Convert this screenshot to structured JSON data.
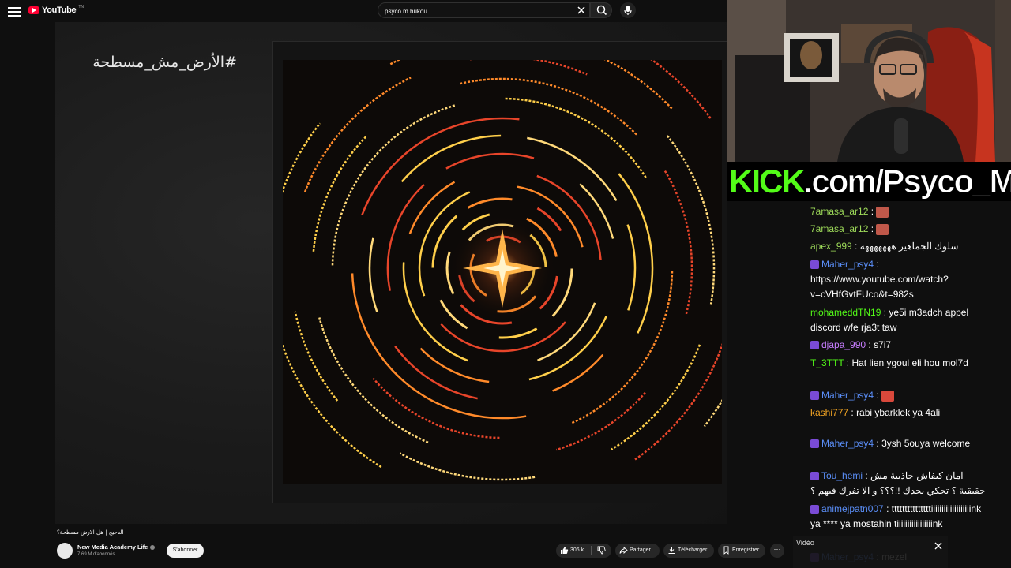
{
  "header": {
    "logo_text": "YouTube",
    "logo_tm": "TN",
    "search": {
      "value": "psyco m hukou"
    }
  },
  "video": {
    "hashtag": "#الأرض_مش_مسطحة",
    "title": "الدحيح | هل الارض مسطحة؟",
    "channel": {
      "name": "New Media Academy Life",
      "subscribers": "7,69 M d'abonnés"
    },
    "subscribe_label": "S'abonner",
    "actions": {
      "likes": "306 k",
      "share": "Partager",
      "download": "Télécharger",
      "save": "Enregistrer",
      "more": "···"
    }
  },
  "stream": {
    "banner": {
      "green": "KICK",
      "rest": ".com/Psyco_M"
    }
  },
  "chat": {
    "messages": [
      {
        "user": "7amasa_ar12",
        "user_color": "#9fdc5a",
        "text": "",
        "emote": true,
        "emote_color": "#c0584a"
      },
      {
        "user": "7amasa_ar12",
        "user_color": "#9fdc5a",
        "text": "",
        "emote": true,
        "emote_color": "#c0584a"
      },
      {
        "user": "apex_999",
        "user_color": "#9fdc5a",
        "text": "سلوك الجماهير هههههههه"
      },
      {
        "user": "Maher_psy4",
        "user_color": "#5b8ff9",
        "text": "https://www.youtube.com/watch?v=cVHfGvtFUco&t=982s"
      },
      {
        "user": "mohameddTN19",
        "user_color": "#53fc18",
        "text": "ye5i m3adch appel discord wfe rja3t taw"
      },
      {
        "user": "djapa_990",
        "user_color": "#c77dff",
        "text": "s7i7"
      },
      {
        "user": "T_3TTT",
        "user_color": "#53fc18",
        "text": "Hat lien ygoul eli hou mol7d"
      },
      {
        "user": "Maher_psy4",
        "user_color": "#5b8ff9",
        "text": "",
        "emote": true,
        "emote_color": "#d9483b"
      },
      {
        "user": "kashi777",
        "user_color": "#f5a623",
        "text": "rabi ybarklek ya 4ali"
      },
      {
        "user": "Maher_psy4",
        "user_color": "#5b8ff9",
        "text": "3ysh 5ouya welcome"
      },
      {
        "user": "Tou_hemi",
        "user_color": "#5b8ff9",
        "text": "امان كيفاش جاذبية مش حقيقية ؟ تحكي بجدك !!؟؟؟ و الا تفرك فيهم ؟"
      },
      {
        "user": "animejpatn007",
        "user_color": "#5b8ff9",
        "text": "tttttttttttttttiiiiiiiiiiiiiiiiiiink ya **** ya mostahin tiiiiiiiiiiiiiiiiink"
      },
      {
        "user": "Maher_psy4",
        "user_color": "#5b8ff9",
        "text": "mezel"
      }
    ]
  },
  "popup": {
    "title": "Vidéo"
  }
}
